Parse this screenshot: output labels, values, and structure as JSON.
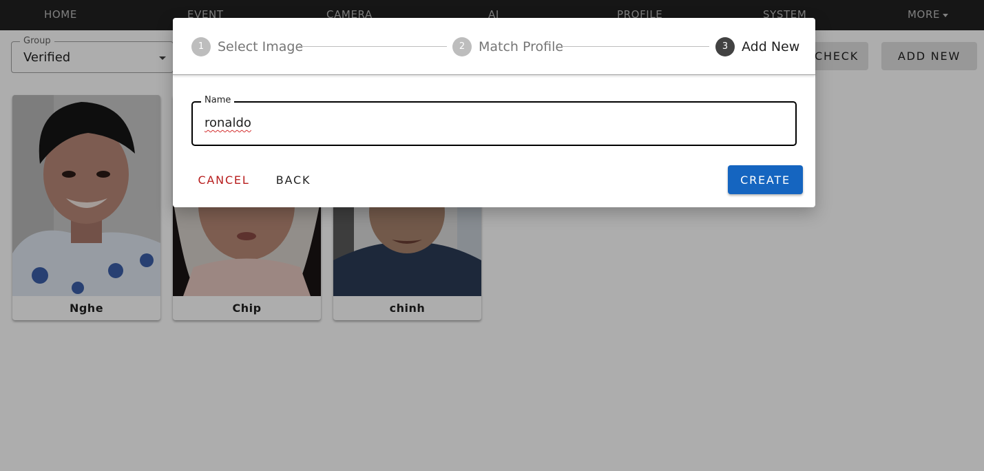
{
  "nav": {
    "items": [
      "HOME",
      "EVENT",
      "CAMERA",
      "AI",
      "PROFILE",
      "SYSTEM"
    ],
    "more_label": "MORE"
  },
  "filter": {
    "group_label": "Group",
    "group_value": "Verified"
  },
  "toolbar": {
    "check_label": "CHECK",
    "add_new_label": "ADD NEW"
  },
  "profiles": [
    {
      "name": "Nghe"
    },
    {
      "name": "Chip"
    },
    {
      "name": "chinh"
    }
  ],
  "dialog": {
    "steps": [
      {
        "number": "1",
        "label": "Select Image",
        "state": "done"
      },
      {
        "number": "2",
        "label": "Match Profile",
        "state": "done"
      },
      {
        "number": "3",
        "label": "Add New",
        "state": "active"
      }
    ],
    "name_field": {
      "label": "Name",
      "value": "ronaldo"
    },
    "cancel_label": "CANCEL",
    "back_label": "BACK",
    "create_label": "CREATE"
  },
  "colors": {
    "navbar": "#212121",
    "primary": "#1565c0",
    "cancel_text": "#b71c1c",
    "active_step": "#424242",
    "inactive_step": "#bdbdbd"
  }
}
